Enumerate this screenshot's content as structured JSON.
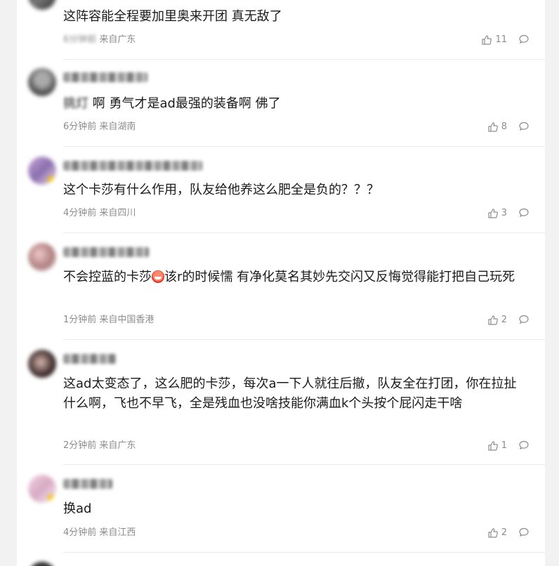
{
  "comments": [
    {
      "text": "这阵容能全程要加里奥来开团 真无敌了",
      "time": "6分钟前",
      "location": "来自广东",
      "likes": "11"
    },
    {
      "text_blurred": "挑灯",
      "text": " 啊 勇气才是ad最强的装备啊 佛了",
      "time": "6分钟前",
      "location": "来自湖南",
      "likes": "8"
    },
    {
      "text": "这个卡莎有什么作用，队友给他养这么肥全是负的？？？",
      "time": "4分钟前",
      "location": "来自四川",
      "likes": "3"
    },
    {
      "text_before_emoji": "不会控蓝的卡莎",
      "emoji": "red-smiling-face",
      "text_after_emoji": "该r的时候懦 有净化莫名其妙先交闪又反悔觉得能打把自己玩死",
      "time": "1分钟前",
      "location": "来自中国香港",
      "likes": "2"
    },
    {
      "text": "这ad太变态了，这么肥的卡莎，每次a一下人就往后撤，队友全在打团，你在拉扯什么啊，飞也不早飞，全是残血也没啥技能你满血k个头按个屁闪走干啥",
      "time": "2分钟前",
      "location": "来自广东",
      "likes": "1"
    },
    {
      "text": "换ad",
      "time": "4分钟前",
      "location": "来自江西",
      "likes": "2"
    }
  ],
  "icons": {
    "like": "thumbs-up-icon",
    "reply": "comment-bubble-icon"
  },
  "colors": {
    "meta": "#8c8c8c",
    "text": "#1a1a1a",
    "background": "#f2f2f2"
  }
}
